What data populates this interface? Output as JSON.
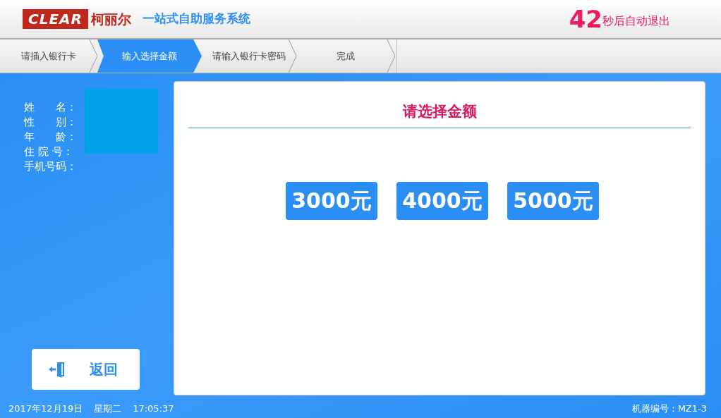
{
  "header": {
    "logo_text": "CLEAR",
    "brand": "柯丽尔",
    "title": "一站式自助服务系统",
    "countdown": "42",
    "countdown_label": "秒后自动退出"
  },
  "steps": [
    {
      "label": "请插入银行卡",
      "selected": false
    },
    {
      "label": "输入选择金额",
      "selected": true
    },
    {
      "label": "请输入银行卡密码",
      "selected": false
    },
    {
      "label": "完成",
      "selected": false
    }
  ],
  "patient_info": {
    "labels": [
      "姓　　名：",
      "性　　别：",
      "年　　龄：",
      "住 院 号：",
      "手机号码："
    ],
    "redacted": true
  },
  "back_button": {
    "label": "返回"
  },
  "panel": {
    "title": "请选择金额",
    "amounts": [
      "3000元",
      "4000元",
      "5000元"
    ]
  },
  "footer": {
    "date": "2017年12月19日",
    "weekday": "星期二",
    "time": "17:05:37",
    "machine_id": "机器编号：MZ1-3"
  }
}
